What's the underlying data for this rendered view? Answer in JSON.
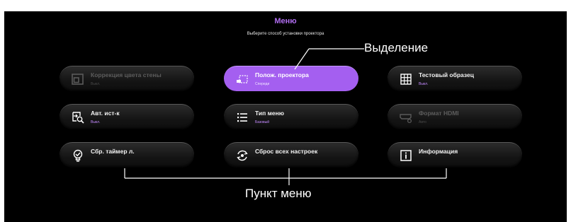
{
  "caption": {
    "text_before": "",
    "text_after": ""
  },
  "menu": {
    "title": "Меню",
    "subtitle": "Выберите способ установки проектора",
    "items": [
      {
        "label": "Коррекция цвета стены",
        "value": "Выкл.",
        "icon": "wall-color-icon",
        "state": "disabled"
      },
      {
        "label": "Полож. проектора",
        "value": "Спереди",
        "icon": "projector-position-icon",
        "state": "selected"
      },
      {
        "label": "Тестовый образец",
        "value": "Выкл.",
        "icon": "test-pattern-grid-icon",
        "state": "normal"
      },
      {
        "label": "Авт. ист-к",
        "value": "Выкл.",
        "icon": "auto-source-icon",
        "state": "normal"
      },
      {
        "label": "Тип меню",
        "value": "Базовый",
        "icon": "menu-list-icon",
        "state": "normal"
      },
      {
        "label": "Формат HDMI",
        "value": "Авто",
        "icon": "hdmi-format-icon",
        "state": "disabled"
      },
      {
        "label": "Сбр. таймер л.",
        "value": "",
        "icon": "lamp-timer-reset-icon",
        "state": "normal"
      },
      {
        "label": "Сброс всех настроек",
        "value": "",
        "icon": "reset-all-icon",
        "state": "normal"
      },
      {
        "label": "Информация",
        "value": "",
        "icon": "info-icon",
        "state": "normal"
      }
    ]
  },
  "callouts": {
    "selection": "Выделение",
    "menu_item": "Пункт меню"
  },
  "colors": {
    "accent": "#a45ff0",
    "title": "#b06df0",
    "background": "#000000"
  }
}
